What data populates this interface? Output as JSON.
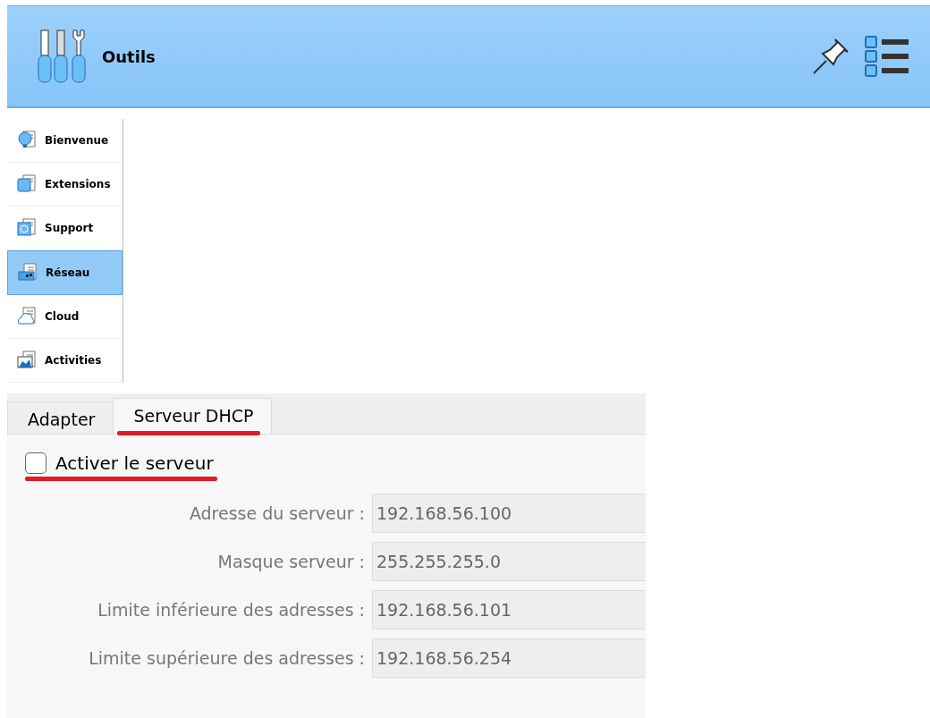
{
  "header": {
    "title": "Outils"
  },
  "sidebar": {
    "items": [
      {
        "label": "Bienvenue",
        "kind": "bulb",
        "selected": false
      },
      {
        "label": "Extensions",
        "kind": "box",
        "selected": false
      },
      {
        "label": "Support",
        "kind": "disk",
        "selected": false
      },
      {
        "label": "Réseau",
        "kind": "network",
        "selected": true
      },
      {
        "label": "Cloud",
        "kind": "cloud",
        "selected": false
      },
      {
        "label": "Activities",
        "kind": "chart",
        "selected": false
      }
    ]
  },
  "tabs": [
    {
      "label": "Adapter",
      "selected": false,
      "underlined": false
    },
    {
      "label": "Serveur DHCP",
      "selected": true,
      "underlined": true
    }
  ],
  "enable_checkbox": {
    "label": "Activer le serveur",
    "checked": false,
    "underlined": true
  },
  "fields": [
    {
      "label": "Adresse du serveur :",
      "value": "192.168.56.100",
      "disabled": true
    },
    {
      "label": "Masque serveur :",
      "value": "255.255.255.0",
      "disabled": true
    },
    {
      "label": "Limite inférieure des adresses :",
      "value": "192.168.56.101",
      "disabled": true
    },
    {
      "label": "Limite supérieure des adresses :",
      "value": "192.168.56.254",
      "disabled": true
    }
  ]
}
